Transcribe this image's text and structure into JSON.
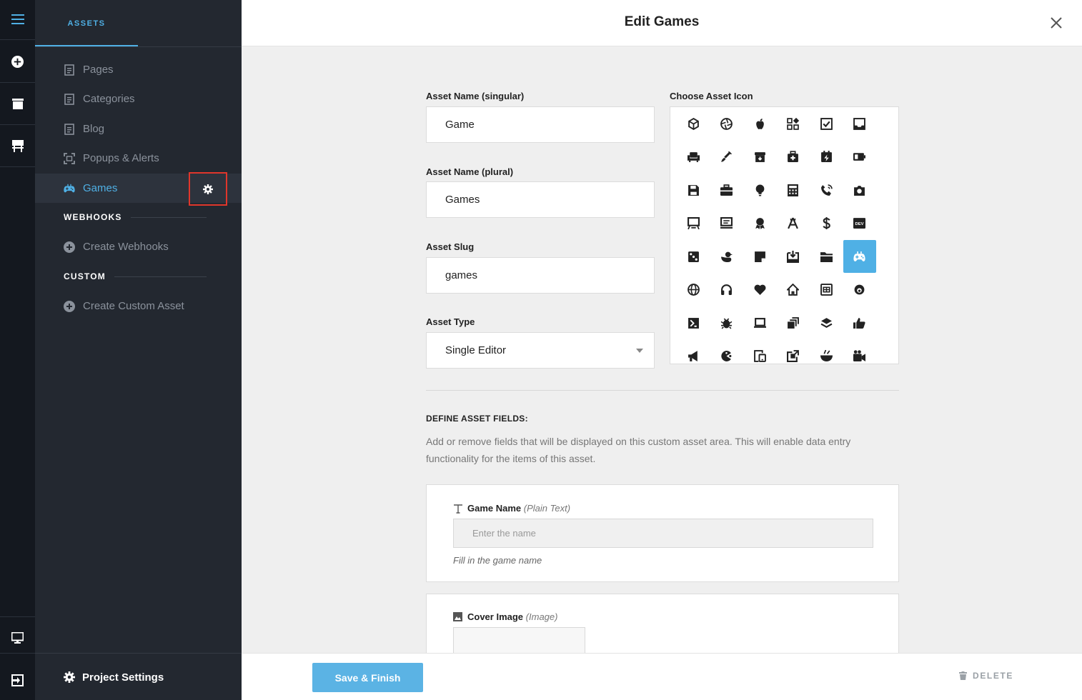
{
  "sidebar": {
    "tab": "ASSETS",
    "items": [
      {
        "label": "Pages",
        "icon": "page-icon"
      },
      {
        "label": "Categories",
        "icon": "page-icon"
      },
      {
        "label": "Blog",
        "icon": "page-icon"
      },
      {
        "label": "Popups & Alerts",
        "icon": "popup-icon"
      },
      {
        "label": "Games",
        "icon": "gamepad-icon",
        "active": true
      }
    ],
    "webhooks_title": "WEBHOOKS",
    "create_webhooks": "Create Webhooks",
    "custom_title": "CUSTOM",
    "create_custom_asset": "Create Custom Asset",
    "project_settings": "Project Settings"
  },
  "header": {
    "title": "Edit Games"
  },
  "form": {
    "singular_label": "Asset Name (singular)",
    "singular_value": "Game",
    "plural_label": "Asset Name (plural)",
    "plural_value": "Games",
    "slug_label": "Asset Slug",
    "slug_value": "games",
    "type_label": "Asset Type",
    "type_value": "Single Editor",
    "icon_label": "Choose Asset Icon"
  },
  "icons": {
    "rows": [
      [
        "cube-icon",
        "aperture-icon",
        "apple-icon",
        "apps-icon",
        "checkbox-icon",
        "inbox-icon"
      ],
      [
        "armchair-icon",
        "syringe-icon",
        "archive-icon",
        "first-aid-icon",
        "calendar-bolt-icon",
        "battery-icon"
      ],
      [
        "save-icon",
        "briefcase-icon",
        "lightbulb-icon",
        "calculator-icon",
        "phone-call-icon",
        "camera-icon"
      ],
      [
        "monitor-stand-icon",
        "screen-icon",
        "award-icon",
        "app-store-icon",
        "dollar-icon",
        "dev-icon"
      ],
      [
        "dice-icon",
        "duck-icon",
        "sticky-note-icon",
        "download-box-icon",
        "folder-icon",
        "gamepad-icon"
      ],
      [
        "globe-icon",
        "headphones-icon",
        "heart-icon",
        "home-icon",
        "gift-card-icon",
        "planet-icon"
      ],
      [
        "sigma-icon",
        "bug-icon",
        "laptop-icon",
        "layers-stack-icon",
        "stack-icon",
        "thumbs-up-icon"
      ],
      [
        "megaphone-icon",
        "pacman-icon",
        "devices-icon",
        "external-box-icon",
        "bowl-icon",
        "video-icon"
      ]
    ],
    "selected": "gamepad-icon",
    "accent": "#4fb0e5"
  },
  "define": {
    "title": "DEFINE ASSET FIELDS:",
    "description": "Add or remove fields that will be displayed on this custom asset area. This will enable data entry functionality for the items of this asset."
  },
  "fields": [
    {
      "name": "Game Name",
      "type": "(Plain Text)",
      "placeholder": "Enter the name",
      "hint": "Fill in the game name"
    },
    {
      "name": "Cover Image",
      "type": "(Image)"
    }
  ],
  "footer": {
    "save": "Save & Finish",
    "delete": "DELETE"
  }
}
